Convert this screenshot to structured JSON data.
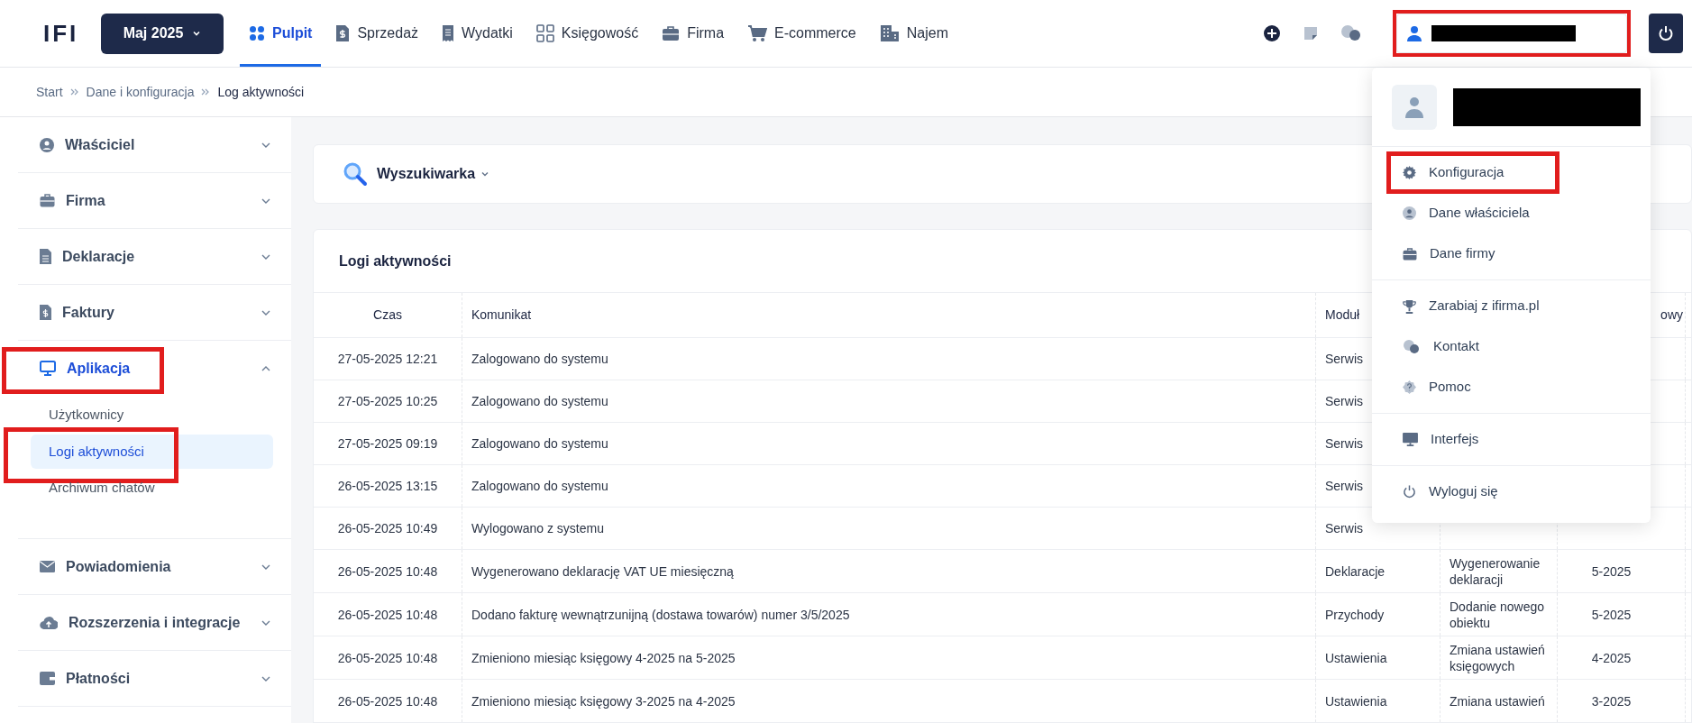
{
  "header": {
    "logo": "IFI",
    "month_button": "Maj 2025",
    "nav": [
      {
        "label": "Pulpit",
        "selected": true
      },
      {
        "label": "Sprzedaż",
        "selected": false
      },
      {
        "label": "Wydatki",
        "selected": false
      },
      {
        "label": "Księgowość",
        "selected": false
      },
      {
        "label": "Firma",
        "selected": false
      },
      {
        "label": "E-commerce",
        "selected": false
      },
      {
        "label": "Najem",
        "selected": false
      }
    ],
    "user_button": {
      "highlighted": true
    }
  },
  "breadcrumb": [
    "Start",
    "Dane i konfiguracja",
    "Log aktywności"
  ],
  "sidebar": [
    {
      "label": "Właściciel",
      "expanded": false,
      "highlighted": false
    },
    {
      "label": "Firma",
      "expanded": false,
      "highlighted": false
    },
    {
      "label": "Deklaracje",
      "expanded": false,
      "highlighted": false
    },
    {
      "label": "Faktury",
      "expanded": false,
      "highlighted": false
    },
    {
      "label": "Aplikacja",
      "expanded": true,
      "highlighted": true,
      "children": [
        {
          "label": "Użytkownicy",
          "selected": false,
          "highlighted": false
        },
        {
          "label": "Logi aktywności",
          "selected": true,
          "highlighted": true
        },
        {
          "label": "Archiwum chatów",
          "selected": false,
          "highlighted": false
        }
      ]
    },
    {
      "label": "Powiadomienia",
      "expanded": false,
      "highlighted": false
    },
    {
      "label": "Rozszerzenia i integracje",
      "expanded": false,
      "highlighted": false
    },
    {
      "label": "Płatności",
      "expanded": false,
      "highlighted": false
    }
  ],
  "search_panel": {
    "label": "Wyszukiwarka"
  },
  "log_table": {
    "title": "Logi aktywności",
    "columns": [
      {
        "label": "Czas"
      },
      {
        "label": "Komunikat"
      },
      {
        "label": "Moduł"
      },
      {},
      {
        "label": "owy"
      }
    ],
    "rows": [
      [
        "27-05-2025 12:21",
        "Zalogowano do systemu",
        "Serwis"
      ],
      [
        "27-05-2025 10:25",
        "Zalogowano do systemu",
        "Serwis"
      ],
      [
        "27-05-2025 09:19",
        "Zalogowano do systemu",
        "Serwis"
      ],
      [
        "26-05-2025 13:15",
        "Zalogowano do systemu",
        "Serwis"
      ],
      [
        "26-05-2025 10:49",
        "Wylogowano z systemu",
        "Serwis"
      ],
      [
        "26-05-2025 10:48",
        "Wygenerowano deklarację VAT UE miesięczną",
        "Deklaracje",
        "Wygenerowanie deklaracji",
        "5-2025"
      ],
      [
        "26-05-2025 10:48",
        "Dodano fakturę wewnątrzunijną (dostawa towarów) numer 3/5/2025",
        "Przychody",
        "Dodanie nowego obiektu",
        "5-2025"
      ],
      [
        "26-05-2025 10:48",
        "Zmieniono miesiąc księgowy 4-2025 na 5-2025",
        "Ustawienia",
        "Zmiana ustawień księgowych",
        "4-2025"
      ],
      [
        "26-05-2025 10:48",
        "Zmieniono miesiąc księgowy 3-2025 na 4-2025",
        "Ustawienia",
        "Zmiana ustawień",
        "3-2025"
      ]
    ]
  },
  "user_menu": {
    "groups": [
      [
        {
          "label": "Konfiguracja",
          "highlighted": true
        },
        {
          "label": "Dane właściciela",
          "highlighted": false
        },
        {
          "label": "Dane firmy",
          "highlighted": false
        }
      ],
      [
        {
          "label": "Zarabiaj z ifirma.pl",
          "highlighted": false
        },
        {
          "label": "Kontakt",
          "highlighted": false
        },
        {
          "label": "Pomoc",
          "highlighted": false
        }
      ],
      [
        {
          "label": "Interfejs",
          "highlighted": false
        }
      ],
      [
        {
          "label": "Wyloguj się",
          "highlighted": false
        }
      ]
    ]
  }
}
